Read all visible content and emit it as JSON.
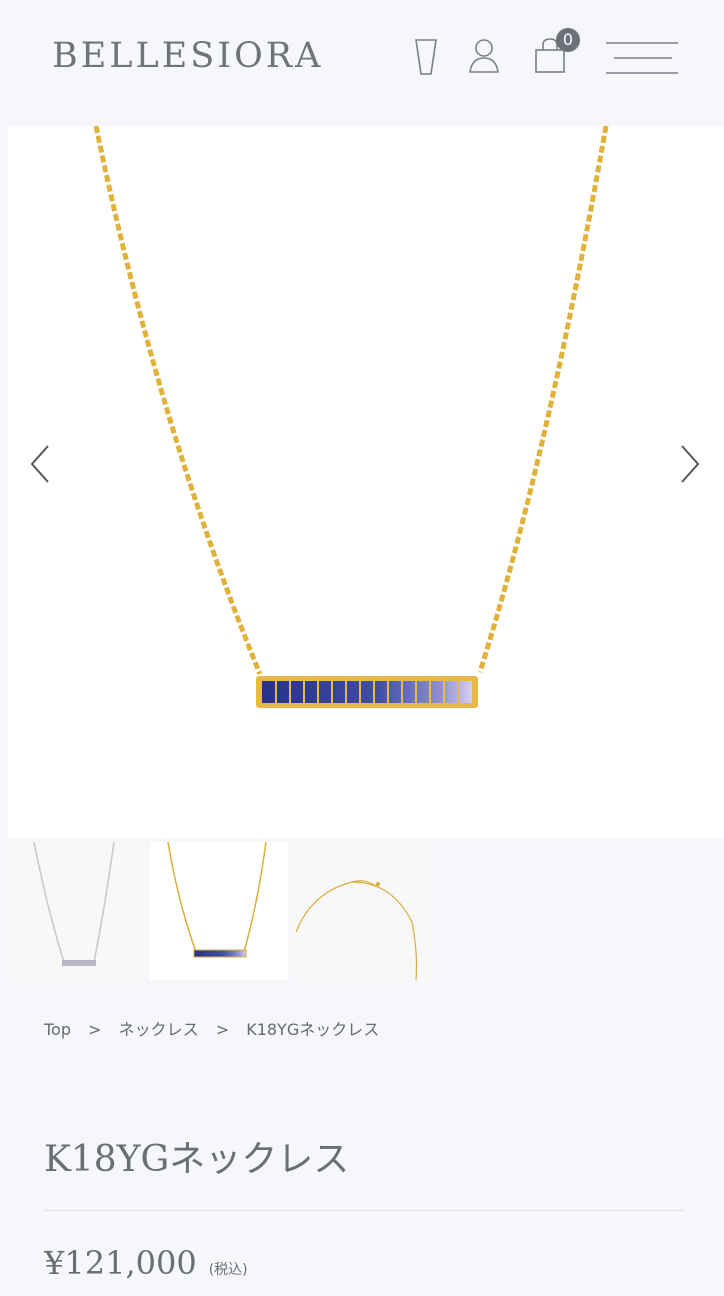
{
  "header": {
    "logo": "BELLESIORA",
    "cart_count": "0",
    "icons": [
      "glass-icon",
      "user-icon",
      "bag-icon",
      "menu-icon"
    ]
  },
  "gallery": {
    "prev_icon": "chevron-left-icon",
    "next_icon": "chevron-right-icon",
    "thumbnails": [
      "silver-necklace",
      "gold-sapphire-bar-necklace",
      "necklace-chain-detail"
    ]
  },
  "breadcrumb": {
    "items": [
      "Top",
      "ネックレス",
      "K18YGネックレス"
    ],
    "separator": ">"
  },
  "product": {
    "title": "K18YGネックレス",
    "price": "¥121,000",
    "tax_note": "(税込)"
  },
  "colors": {
    "background": "#f5f7fa",
    "gold": "#e2b33c",
    "sapphire_dark": "#2e3a8c",
    "sapphire_light": "#c9c3ea"
  }
}
